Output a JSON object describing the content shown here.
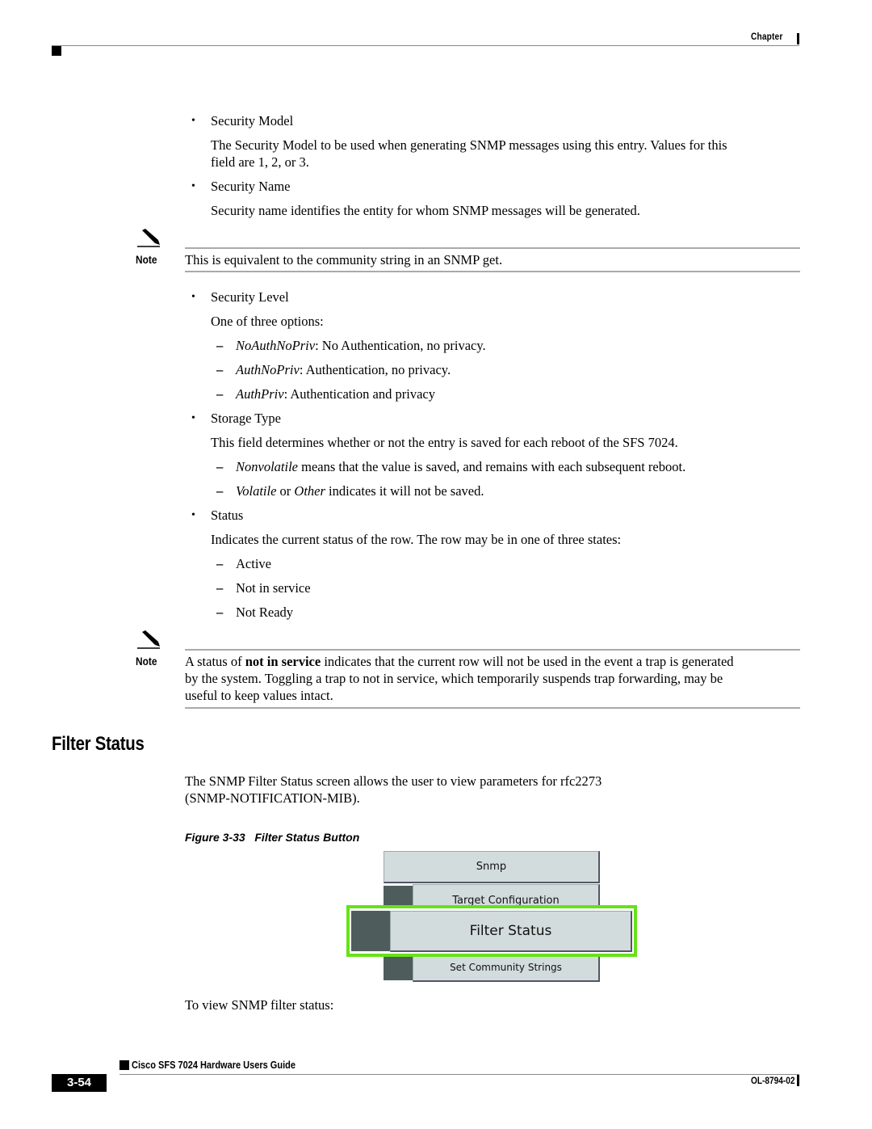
{
  "header": {
    "chapter_label": "Chapter"
  },
  "content": {
    "security_model": {
      "bullet": "Security Model",
      "desc_line1": "The Security Model to be used when generating SNMP messages using this entry. Values for this",
      "desc_line2": "field are 1, 2, or 3."
    },
    "security_name": {
      "bullet": "Security Name",
      "desc": "Security name identifies the entity for whom SNMP messages will be generated."
    },
    "note1": {
      "label": "Note",
      "text": "This is equivalent to the community string in an SNMP get."
    },
    "security_level": {
      "bullet": "Security Level",
      "intro": "One of three options:",
      "options": [
        {
          "term": "NoAuthNoPriv",
          "desc": ": No Authentication, no privacy."
        },
        {
          "term": "AuthNoPriv",
          "desc": ": Authentication, no privacy."
        },
        {
          "term": "AuthPriv",
          "desc": ": Authentication and privacy"
        }
      ]
    },
    "storage_type": {
      "bullet": "Storage Type",
      "desc": "This field determines whether or not the entry is saved for each reboot of the SFS 7024.",
      "options": [
        {
          "term": "Nonvolatile",
          "desc": " means that the value is saved, and remains with each subsequent reboot."
        },
        {
          "term": "Volatile",
          "mid": " or ",
          "term2": "Other",
          "desc": " indicates it will not be saved."
        }
      ]
    },
    "status": {
      "bullet": "Status",
      "desc": "Indicates the current status of the row. The row may be in one of three states:",
      "states": [
        "Active",
        "Not in service",
        "Not Ready"
      ]
    },
    "note2": {
      "label": "Note",
      "line1_pre": "A status of ",
      "line1_bold": "not in service",
      "line1_post": " indicates that the current row will not be used in the event a trap is generated",
      "line2": "by the system. Toggling a trap to not in service, which temporarily suspends trap forwarding, may be",
      "line3": "useful to keep values intact."
    },
    "section_title": "Filter Status",
    "intro_line1": "The SNMP Filter Status screen allows the user to view parameters for rfc2273",
    "intro_line2": "(SNMP-NOTIFICATION-MIB).",
    "figure": {
      "caption_num": "Figure 3-33",
      "caption_title": "Filter Status Button",
      "buttons": [
        "Snmp",
        "Target Configuration",
        "Filter Status",
        "Set Community Strings"
      ],
      "highlight_color": "#66e21a"
    },
    "closing": "To view SNMP filter status:"
  },
  "footer": {
    "guide_title": "Cisco SFS 7024 Hardware Users Guide",
    "page_number": "3-54",
    "doc_number": "OL-8794-02"
  }
}
